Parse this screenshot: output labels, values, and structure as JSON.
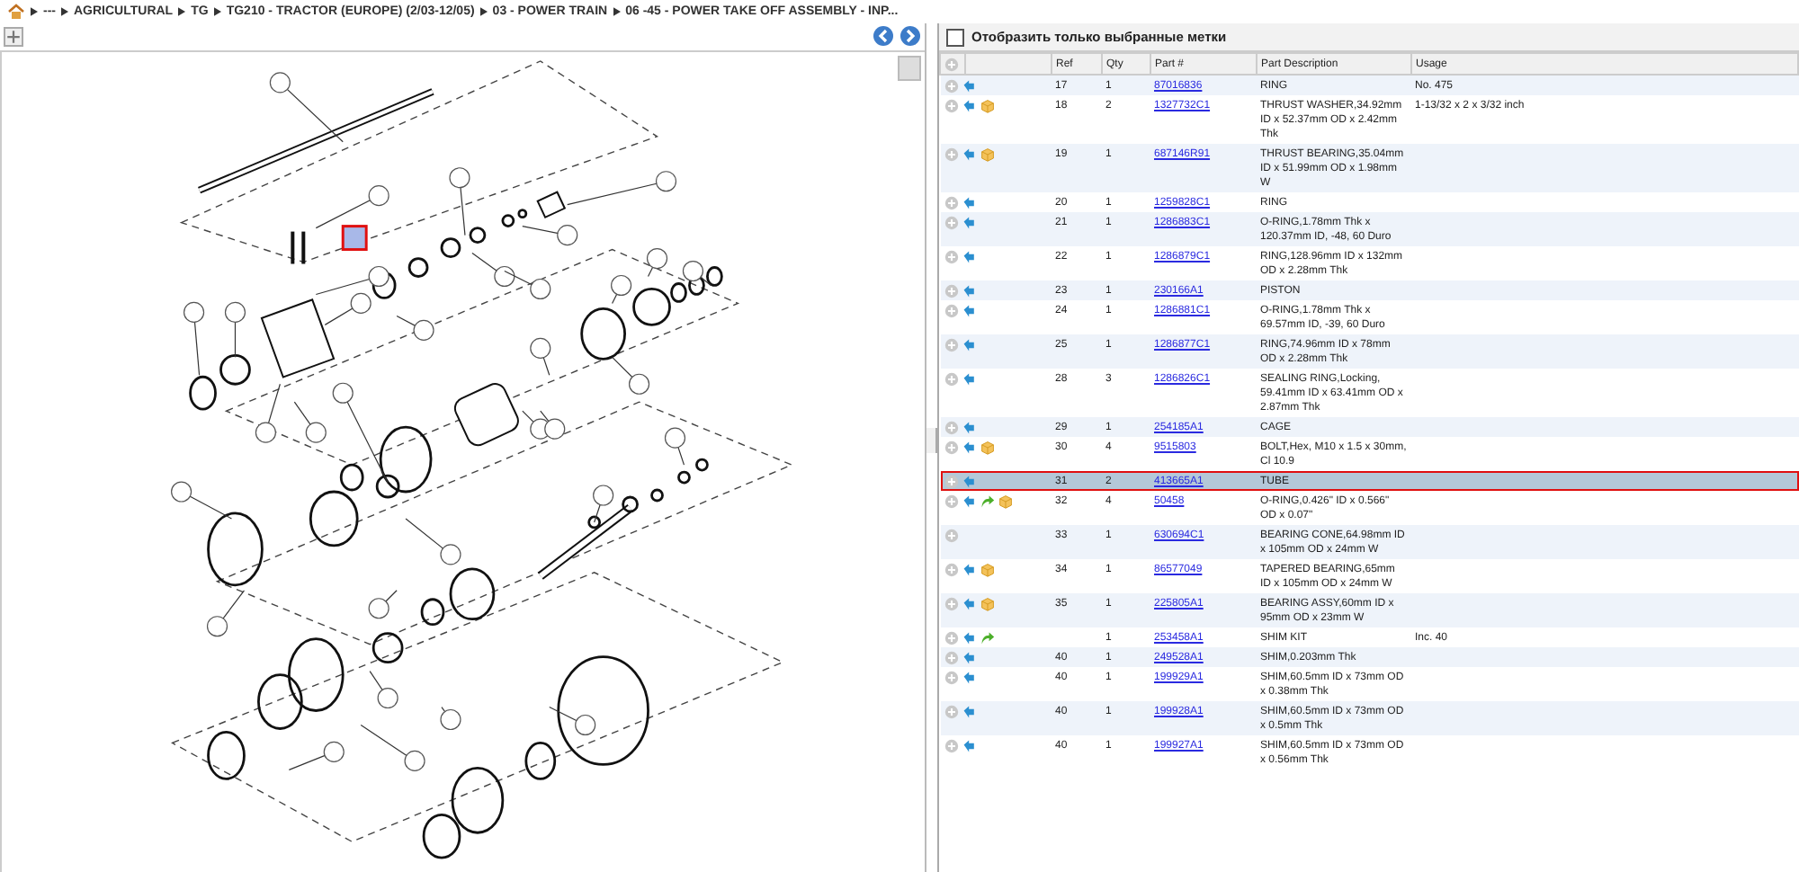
{
  "breadcrumb": [
    {
      "label": "---"
    },
    {
      "label": "AGRICULTURAL"
    },
    {
      "label": "TG"
    },
    {
      "label": "TG210 - TRACTOR (EUROPE) (2/03-12/05)"
    },
    {
      "label": "03 - POWER TRAIN"
    },
    {
      "label": "06 -45 - POWER TAKE OFF ASSEMBLY - INP..."
    }
  ],
  "filter": {
    "label": "Отобразить только выбранные метки",
    "checked": false
  },
  "columns": [
    "Ref",
    "Qty",
    "Part #",
    "Part Description",
    "Usage"
  ],
  "rows": [
    {
      "ref": "17",
      "qty": "1",
      "part": "87016836",
      "description": "RING",
      "usage": "No. 475",
      "back": true,
      "forward": false,
      "package": false,
      "selected": false
    },
    {
      "ref": "18",
      "qty": "2",
      "part": "1327732C1",
      "description": "THRUST WASHER,34.92mm ID x 52.37mm OD x 2.42mm Thk",
      "usage": "1-13/32 x 2 x 3/32 inch",
      "back": true,
      "forward": false,
      "package": true,
      "selected": false
    },
    {
      "ref": "19",
      "qty": "1",
      "part": "687146R91",
      "description": "THRUST BEARING,35.04mm ID x 51.99mm OD x 1.98mm W",
      "back": true,
      "forward": false,
      "package": true,
      "selected": false
    },
    {
      "ref": "20",
      "qty": "1",
      "part": "1259828C1",
      "description": "RING",
      "back": true,
      "forward": false,
      "package": false,
      "selected": false
    },
    {
      "ref": "21",
      "qty": "1",
      "part": "1286883C1",
      "description": "O-RING,1.78mm Thk x 120.37mm ID, -48, 60 Duro",
      "back": true,
      "forward": false,
      "package": false,
      "selected": false
    },
    {
      "ref": "22",
      "qty": "1",
      "part": "1286879C1",
      "description": "RING,128.96mm ID x 132mm OD x 2.28mm Thk",
      "back": true,
      "forward": false,
      "package": false,
      "selected": false
    },
    {
      "ref": "23",
      "qty": "1",
      "part": "230166A1",
      "description": "PISTON",
      "back": true,
      "forward": false,
      "package": false,
      "selected": false
    },
    {
      "ref": "24",
      "qty": "1",
      "part": "1286881C1",
      "description": "O-RING,1.78mm Thk x 69.57mm ID, -39, 60 Duro",
      "back": true,
      "forward": false,
      "package": false,
      "selected": false
    },
    {
      "ref": "25",
      "qty": "1",
      "part": "1286877C1",
      "description": "RING,74.96mm ID x 78mm OD x 2.28mm Thk",
      "back": true,
      "forward": false,
      "package": false,
      "selected": false
    },
    {
      "ref": "28",
      "qty": "3",
      "part": "1286826C1",
      "description": "SEALING RING,Locking, 59.41mm ID x 63.41mm OD x 2.87mm Thk",
      "back": true,
      "forward": false,
      "package": false,
      "selected": false
    },
    {
      "ref": "29",
      "qty": "1",
      "part": "254185A1",
      "description": "CAGE",
      "back": true,
      "forward": false,
      "package": false,
      "selected": false
    },
    {
      "ref": "30",
      "qty": "4",
      "part": "9515803",
      "description": "BOLT,Hex, M10 x 1.5 x 30mm, Cl 10.9",
      "back": true,
      "forward": false,
      "package": true,
      "selected": false
    },
    {
      "ref": "31",
      "qty": "2",
      "part": "413665A1",
      "description": "TUBE",
      "back": true,
      "forward": false,
      "package": false,
      "selected": true
    },
    {
      "ref": "32",
      "qty": "4",
      "part": "50458",
      "description": "O-RING,0.426\" ID x 0.566\" OD x 0.07\"",
      "back": true,
      "forward": true,
      "package": true,
      "selected": false
    },
    {
      "ref": "33",
      "qty": "1",
      "part": "630694C1",
      "description": "BEARING CONE,64.98mm ID x 105mm OD x 24mm W",
      "back": false,
      "forward": false,
      "package": false,
      "selected": false
    },
    {
      "ref": "34",
      "qty": "1",
      "part": "86577049",
      "description": "TAPERED BEARING,65mm ID x 105mm OD x 24mm W",
      "back": true,
      "forward": false,
      "package": true,
      "selected": false
    },
    {
      "ref": "35",
      "qty": "1",
      "part": "225805A1",
      "description": "BEARING ASSY,60mm ID x 95mm OD x 23mm W",
      "back": true,
      "forward": false,
      "package": true,
      "selected": false
    },
    {
      "qty": "1",
      "part": "253458A1",
      "description": "SHIM KIT",
      "usage": "Inc. 40",
      "back": true,
      "forward": true,
      "package": false,
      "selected": false
    },
    {
      "ref": "40",
      "qty": "1",
      "part": "249528A1",
      "description": "SHIM,0.203mm Thk",
      "back": true,
      "forward": false,
      "package": false,
      "selected": false
    },
    {
      "ref": "40",
      "qty": "1",
      "part": "199929A1",
      "description": "SHIM,60.5mm ID x 73mm OD x 0.38mm Thk",
      "back": true,
      "forward": false,
      "package": false,
      "selected": false
    },
    {
      "ref": "40",
      "qty": "1",
      "part": "199928A1",
      "description": "SHIM,60.5mm ID x 73mm OD x 0.5mm Thk",
      "back": true,
      "forward": false,
      "package": false,
      "selected": false
    },
    {
      "ref": "40",
      "qty": "1",
      "part": "199927A1",
      "description": "SHIM,60.5mm ID x 73mm OD x 0.56mm Thk",
      "back": true,
      "forward": false,
      "package": false,
      "selected": false
    }
  ]
}
